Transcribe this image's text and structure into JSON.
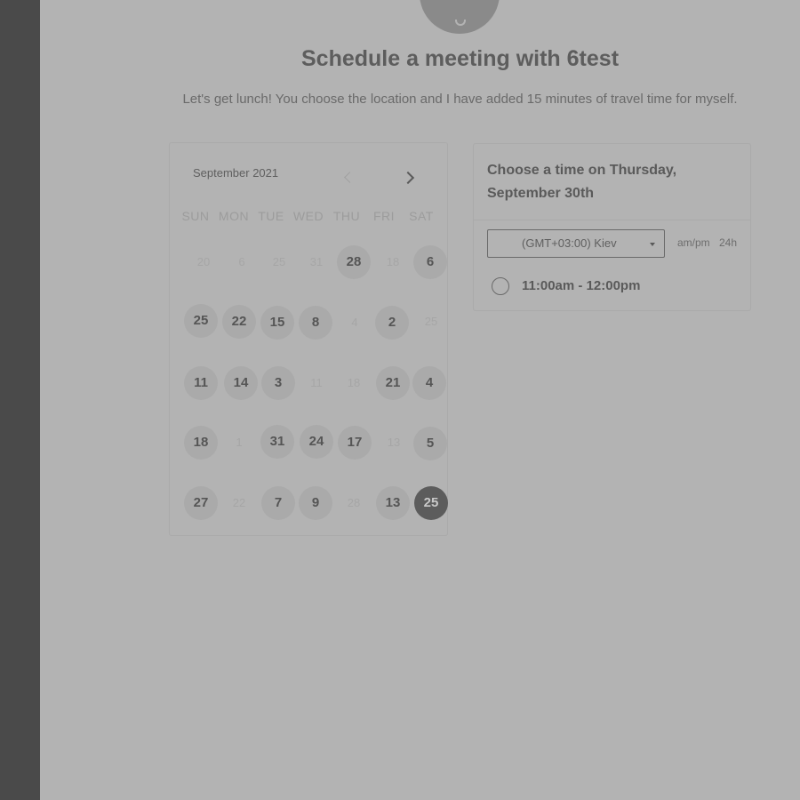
{
  "title": "Schedule a meeting with 6test",
  "subtitle": "Let's get lunch! You choose the location and I have added 15 minutes of travel time for myself.",
  "calendar": {
    "month_label": "September 2021",
    "weekdays": [
      "SUN",
      "MON",
      "TUE",
      "WED",
      "THU",
      "FRI",
      "SAT"
    ],
    "rows": [
      [
        "20",
        "6",
        "25",
        "31",
        "28",
        "18",
        "6"
      ],
      [
        "25",
        "22",
        "15",
        "8",
        "4",
        "2",
        "25"
      ],
      [
        "11",
        "14",
        "3",
        "11",
        "18",
        "21",
        "4"
      ],
      [
        "18",
        "1",
        "31",
        "24",
        "17",
        "13",
        "5"
      ],
      [
        "27",
        "22",
        "7",
        "9",
        "28",
        "13",
        "25"
      ]
    ]
  },
  "time_panel": {
    "header": "Choose a time on Thursday, September 30th",
    "timezone": "(GMT+03:00) Kiev",
    "format_ampm": "am/pm",
    "format_24h": "24h",
    "slot": "11:00am - 12:00pm"
  },
  "colors": {
    "sidebar": "#4a4a4a",
    "background": "#b3b3b3",
    "selected_day": "#5c5c5c"
  }
}
